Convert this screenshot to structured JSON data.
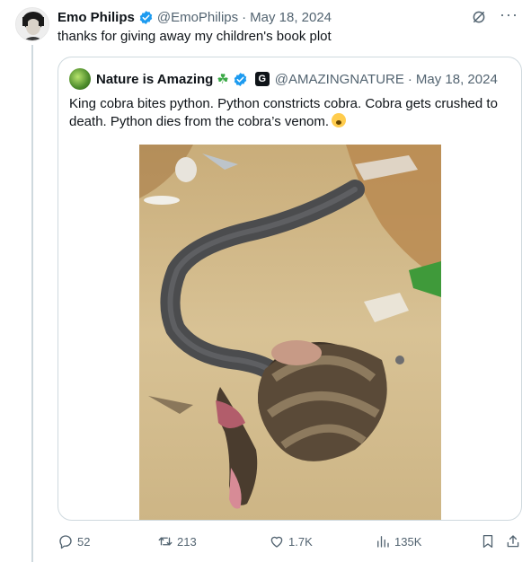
{
  "tweet": {
    "author_name": "Emo Philips",
    "handle": "@EmoPhilips",
    "separator": "·",
    "date": "May 18, 2024",
    "text": "thanks for giving away my children's book plot",
    "more_label": "···"
  },
  "quoted": {
    "author_name": "Nature is Amazing",
    "clover": "☘",
    "badge_letter": "G",
    "handle": "@AMAZINGNATURE",
    "separator": "·",
    "date": "May 18, 2024",
    "text": "King cobra bites python. Python constricts cobra. Cobra gets crushed to death. Python dies from the cobra’s venom."
  },
  "actions": {
    "replies": "52",
    "reposts": "213",
    "likes": "1.7K",
    "views": "135K"
  },
  "colors": {
    "verified_blue": "#1d9bf0",
    "muted_text": "#536471",
    "border": "#cfd9de"
  },
  "icons": [
    "verified-icon",
    "grok-icon",
    "more-icon",
    "reply-icon",
    "repost-icon",
    "like-icon",
    "views-icon",
    "bookmark-icon",
    "share-icon"
  ]
}
